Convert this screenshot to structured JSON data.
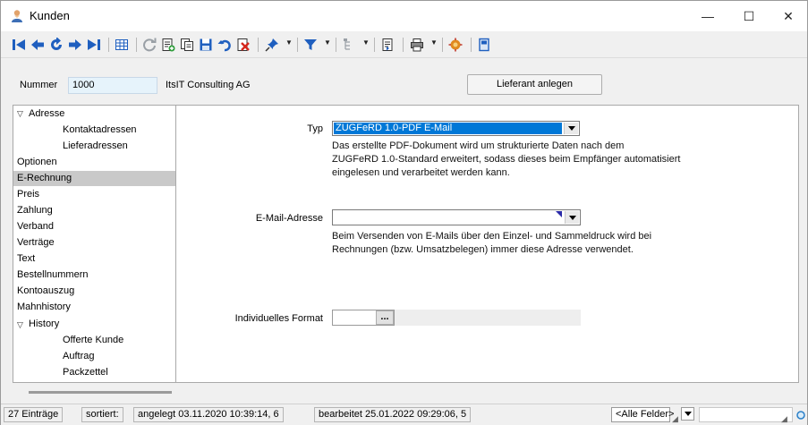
{
  "window": {
    "title": "Kunden",
    "controls": {
      "minimize": "—",
      "maximize": "☐",
      "close": "✕"
    }
  },
  "toolbar": {
    "icons": [
      "first-record-icon",
      "prev-record-icon",
      "refresh-record-icon",
      "next-record-icon",
      "last-record-icon",
      "table-view-icon",
      "reload-icon",
      "new-record-icon",
      "copy-record-icon",
      "save-icon",
      "undo-icon",
      "delete-icon",
      "pin-icon",
      "filter-icon",
      "tree-icon",
      "document-icon",
      "print-icon",
      "settings-icon",
      "exit-icon"
    ]
  },
  "header": {
    "nummer_label": "Nummer",
    "nummer_value": "1000",
    "company_name": "ItsIT Consulting AG",
    "lieferant_button": "Lieferant anlegen"
  },
  "sidebar": {
    "items": [
      {
        "label": "Adresse",
        "level": 0,
        "expander": "⌄"
      },
      {
        "label": "Kontaktadressen",
        "level": 2
      },
      {
        "label": "Lieferadressen",
        "level": 2
      },
      {
        "label": "Optionen",
        "level": 0
      },
      {
        "label": "E-Rechnung",
        "level": 0,
        "selected": true
      },
      {
        "label": "Preis",
        "level": 0
      },
      {
        "label": "Zahlung",
        "level": 0
      },
      {
        "label": "Verband",
        "level": 0
      },
      {
        "label": "Verträge",
        "level": 0
      },
      {
        "label": "Text",
        "level": 0
      },
      {
        "label": "Bestellnummern",
        "level": 0
      },
      {
        "label": "Kontoauszug",
        "level": 0
      },
      {
        "label": "Mahnhistory",
        "level": 0
      },
      {
        "label": "History",
        "level": 0,
        "expander": "⌄"
      },
      {
        "label": "Offerte Kunde",
        "level": 2
      },
      {
        "label": "Auftrag",
        "level": 2
      },
      {
        "label": "Packzettel",
        "level": 2
      }
    ]
  },
  "form": {
    "typ_label": "Typ",
    "typ_value": "ZUGFeRD 1.0-PDF E-Mail",
    "typ_desc_1": "Das erstellte PDF-Dokument wird um strukturierte Daten nach dem",
    "typ_desc_2": "ZUGFeRD 1.0-Standard erweitert, sodass dieses beim Empfänger automatisiert",
    "typ_desc_3": "eingelesen und verarbeitet werden kann.",
    "email_label": "E-Mail-Adresse",
    "email_value": "",
    "email_desc_1": "Beim Versenden von E-Mails über den Einzel- und Sammeldruck wird bei",
    "email_desc_2": "Rechnungen (bzw. Umsatzbelegen) immer diese Adresse verwendet.",
    "format_label": "Individuelles Format",
    "format_value": "",
    "format_button": "..."
  },
  "statusbar": {
    "count": "27 Einträge",
    "sorted": "sortiert:",
    "created": "angelegt 03.11.2020 10:39:14, 6",
    "edited": "bearbeitet 25.01.2022 09:29:06, 5",
    "filter_value": "<Alle Felder>"
  },
  "colors": {
    "selection_blue": "#0078d7",
    "selected_nav": "#c9c9c9",
    "nummer_field_bg": "#e6f3fb"
  }
}
